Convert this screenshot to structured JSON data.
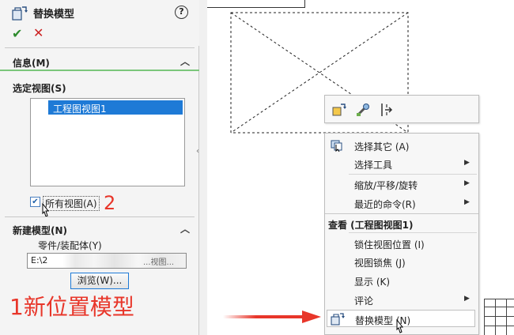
{
  "panel": {
    "title": "替换模型",
    "help": "?",
    "ok": "✔",
    "cancel": "✕",
    "info_section": "信息(M)",
    "selected_views_section": "选定视图(S)",
    "views": [
      "工程图视图1"
    ],
    "all_views_label": "所有视图(A)",
    "all_views_checked": true,
    "new_model_section": "新建模型(N)",
    "component_label": "零件/装配体(Y)",
    "path_value": "E:\\2",
    "path_tail": "...视图...",
    "browse_button": "浏览(W)..."
  },
  "annotations": {
    "step_2": "2",
    "step_1": "1新位置模型"
  },
  "context_menu": {
    "toolbar_icons": [
      "replace-model-icon",
      "repair-icon",
      "move-icon"
    ],
    "items_group1": [
      {
        "label": "选择其它 (A)",
        "icon": "select-other-icon",
        "submenu": false
      },
      {
        "label": "选择工具",
        "submenu": true
      },
      {
        "label": "缩放/平移/旋转",
        "submenu": true
      },
      {
        "label": "最近的命令(R)",
        "submenu": true
      }
    ],
    "header": "查看 (工程图视图1)",
    "items_group2": [
      {
        "label": "锁住视图位置 (I)",
        "submenu": false
      },
      {
        "label": "视图锁焦 (J)",
        "submenu": false
      },
      {
        "label": "显示 (K)",
        "submenu": false
      },
      {
        "label": "评论",
        "submenu": true
      },
      {
        "label": "替换模型 (N)",
        "icon": "replace-model-icon",
        "submenu": false,
        "highlighted": true
      }
    ]
  },
  "colors": {
    "annotation_red": "#e8362a",
    "selection_blue": "#1e7ad6",
    "info_underline_green": "#7bc67b"
  }
}
